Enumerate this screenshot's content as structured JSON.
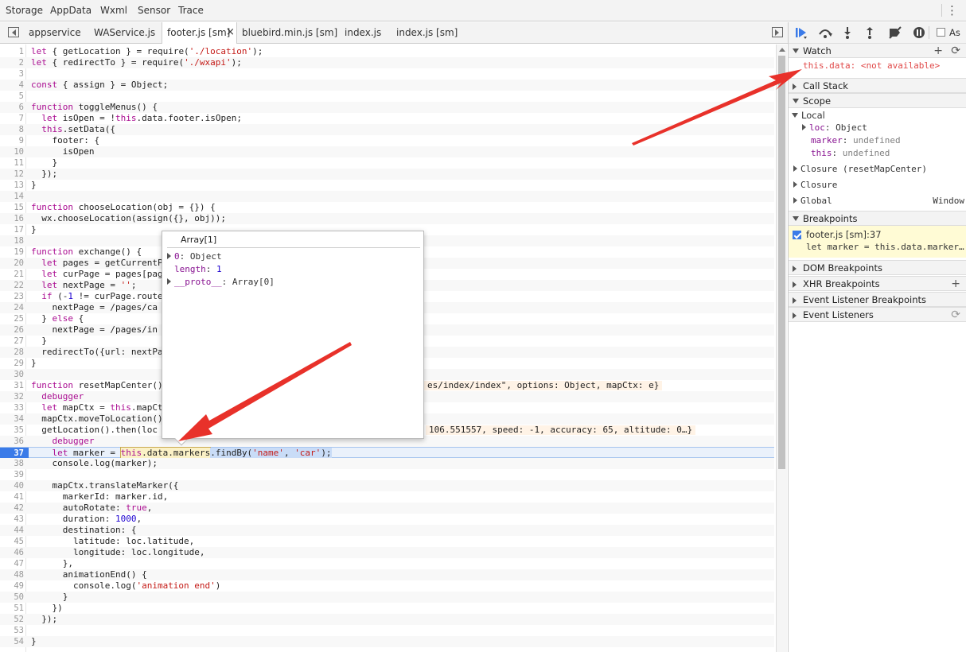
{
  "top_tabs": [
    "Storage",
    "AppData",
    "Wxml",
    "Sensor",
    "Trace"
  ],
  "file_tabs": [
    "appservice",
    "WAService.js",
    "footer.js [sm]",
    "bluebird.min.js [sm]",
    "index.js",
    "index.js [sm]"
  ],
  "active_file_tab": "footer.js [sm]",
  "code_lines": [
    {
      "n": "1",
      "t": "let { getLocation } = require('./location');"
    },
    {
      "n": "2",
      "t": "let { redirectTo } = require('./wxapi');"
    },
    {
      "n": "3",
      "t": ""
    },
    {
      "n": "4",
      "t": "const { assign } = Object;"
    },
    {
      "n": "5",
      "t": ""
    },
    {
      "n": "6",
      "t": "function toggleMenus() {"
    },
    {
      "n": "7",
      "t": "  let isOpen = !this.data.footer.isOpen;"
    },
    {
      "n": "8",
      "t": "  this.setData({"
    },
    {
      "n": "9",
      "t": "    footer: {"
    },
    {
      "n": "10",
      "t": "      isOpen"
    },
    {
      "n": "11",
      "t": "    }"
    },
    {
      "n": "12",
      "t": "  });"
    },
    {
      "n": "13",
      "t": "}"
    },
    {
      "n": "14",
      "t": ""
    },
    {
      "n": "15",
      "t": "function chooseLocation(obj = {}) {"
    },
    {
      "n": "16",
      "t": "  wx.chooseLocation(assign({}, obj));"
    },
    {
      "n": "17",
      "t": "}"
    },
    {
      "n": "18",
      "t": ""
    },
    {
      "n": "19",
      "t": "function exchange() {"
    },
    {
      "n": "20",
      "t": "  let pages = getCurrentP"
    },
    {
      "n": "21",
      "t": "  let curPage = pages[pag"
    },
    {
      "n": "22",
      "t": "  let nextPage = '';"
    },
    {
      "n": "23",
      "t": "  if (-1 != curPage.route"
    },
    {
      "n": "24",
      "t": "    nextPage = '/pages/ca"
    },
    {
      "n": "25",
      "t": "  } else {"
    },
    {
      "n": "26",
      "t": "    nextPage = '/pages/in"
    },
    {
      "n": "27",
      "t": "  }"
    },
    {
      "n": "28",
      "t": "  redirectTo({url: nextPa"
    },
    {
      "n": "29",
      "t": "}"
    },
    {
      "n": "30",
      "t": ""
    },
    {
      "n": "31",
      "t": "function resetMapCenter()"
    },
    {
      "n": "32",
      "t": "  debugger"
    },
    {
      "n": "33",
      "t": "  let mapCtx = this.mapCt"
    },
    {
      "n": "34",
      "t": "  mapCtx.moveToLocation()"
    },
    {
      "n": "35",
      "t": "  getLocation().then(loc"
    },
    {
      "n": "36",
      "t": "    debugger"
    },
    {
      "n": "37",
      "t": "    let marker = this.data.markers.findBy('name', 'car');"
    },
    {
      "n": "38",
      "t": "    console.log(marker);"
    },
    {
      "n": "39",
      "t": ""
    },
    {
      "n": "40",
      "t": "    mapCtx.translateMarker({"
    },
    {
      "n": "41",
      "t": "      markerId: marker.id,"
    },
    {
      "n": "42",
      "t": "      autoRotate: true,"
    },
    {
      "n": "43",
      "t": "      duration: 1000,"
    },
    {
      "n": "44",
      "t": "      destination: {"
    },
    {
      "n": "45",
      "t": "        latitude: loc.latitude,"
    },
    {
      "n": "46",
      "t": "        longitude: loc.longitude,"
    },
    {
      "n": "47",
      "t": "      },"
    },
    {
      "n": "48",
      "t": "      animationEnd() {"
    },
    {
      "n": "49",
      "t": "        console.log('animation end')"
    },
    {
      "n": "50",
      "t": "      }"
    },
    {
      "n": "51",
      "t": "    })"
    },
    {
      "n": "52",
      "t": "  });"
    },
    {
      "n": "53",
      "t": ""
    },
    {
      "n": "54",
      "t": "}"
    }
  ],
  "current_line": "37",
  "inline_values": {
    "line31": "es/index/index\", options: Object, mapCtx: e}",
    "line35": "106.551557, speed: -1, accuracy: 65, altitude: 0…}"
  },
  "line37_parts": {
    "indent": "    ",
    "before": "let marker = ",
    "highlight": "this.data.markers",
    "after": ".findBy('name', 'car');"
  },
  "popover": {
    "title": "Array[1]",
    "row1_key": "0",
    "row1_val": "Object",
    "row2_key": "length",
    "row2_val": "1",
    "row3_key": "__proto__",
    "row3_val": "Array[0]"
  },
  "watch": {
    "header": "Watch",
    "expr": "this.data",
    "value": "<not available>"
  },
  "call_stack": {
    "header": "Call Stack"
  },
  "scope": {
    "header": "Scope",
    "local_label": "Local",
    "loc_key": "loc",
    "loc_val": "Object",
    "marker_key": "marker",
    "marker_val": "undefined",
    "this_key": "this",
    "this_val": "undefined",
    "closure1": "Closure (resetMapCenter)",
    "closure2": "Closure",
    "global_label": "Global",
    "global_val": "Window"
  },
  "breakpoints": {
    "header": "Breakpoints",
    "file": "footer.js [sm]:37",
    "code": "let marker = this.data.marker…"
  },
  "dom_breakpoints": "DOM Breakpoints",
  "xhr_breakpoints": "XHR Breakpoints",
  "event_listener_breakpoints": "Event Listener Breakpoints",
  "event_listeners": "Event Listeners",
  "async_label": "As",
  "colors": {
    "accent": "#3b7be8",
    "breakpoint_bg": "#fffbd5",
    "arrow_red": "#e8312a"
  }
}
